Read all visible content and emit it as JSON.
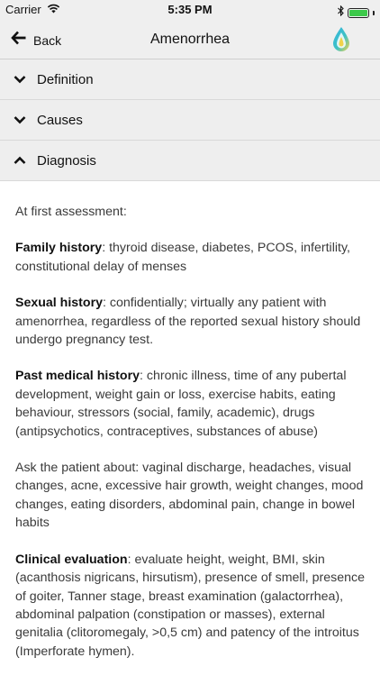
{
  "status_bar": {
    "carrier": "Carrier",
    "time": "5:35 PM",
    "battery_level": 1.0,
    "battery_color": "#3cc94a"
  },
  "nav": {
    "back_label": "Back",
    "title": "Amenorrhea"
  },
  "sections": [
    {
      "label": "Definition",
      "state": "collapsed"
    },
    {
      "label": "Causes",
      "state": "collapsed"
    },
    {
      "label": "Diagnosis",
      "state": "expanded"
    }
  ],
  "content": {
    "intro": "At first assessment:",
    "family_history": {
      "heading": "Family history",
      "text": ": thyroid disease, diabetes, PCOS, infertility, constitutional delay of menses"
    },
    "sexual_history": {
      "heading": "Sexual history",
      "text": ": confidentially; virtually any patient with amenorrhea, regardless of the reported sexual history should undergo pregnancy test."
    },
    "past_medical_history": {
      "heading": "Past medical history",
      "text": ": chronic illness, time of any pubertal development, weight gain or loss, exercise habits, eating behaviour, stressors (social, family, academic), drugs (antipsychotics, contraceptives, substances of abuse)"
    },
    "ask_patient": "Ask the patient about: vaginal discharge, headaches, visual changes, acne, excessive hair growth, weight changes, mood changes, eating disorders, abdominal pain, change in bowel habits",
    "clinical_evaluation": {
      "heading": "Clinical evaluation",
      "text": ": evaluate height, weight, BMI, skin (acanthosis nigricans, hirsutism), presence of smell, presence of goiter, Tanner stage, breast examination (galactorrhea), abdominal palpation (constipation or masses), external genitalia (clitoromegaly, >0,5 cm) and patency of the introitus (Imperforate hymen)."
    }
  }
}
